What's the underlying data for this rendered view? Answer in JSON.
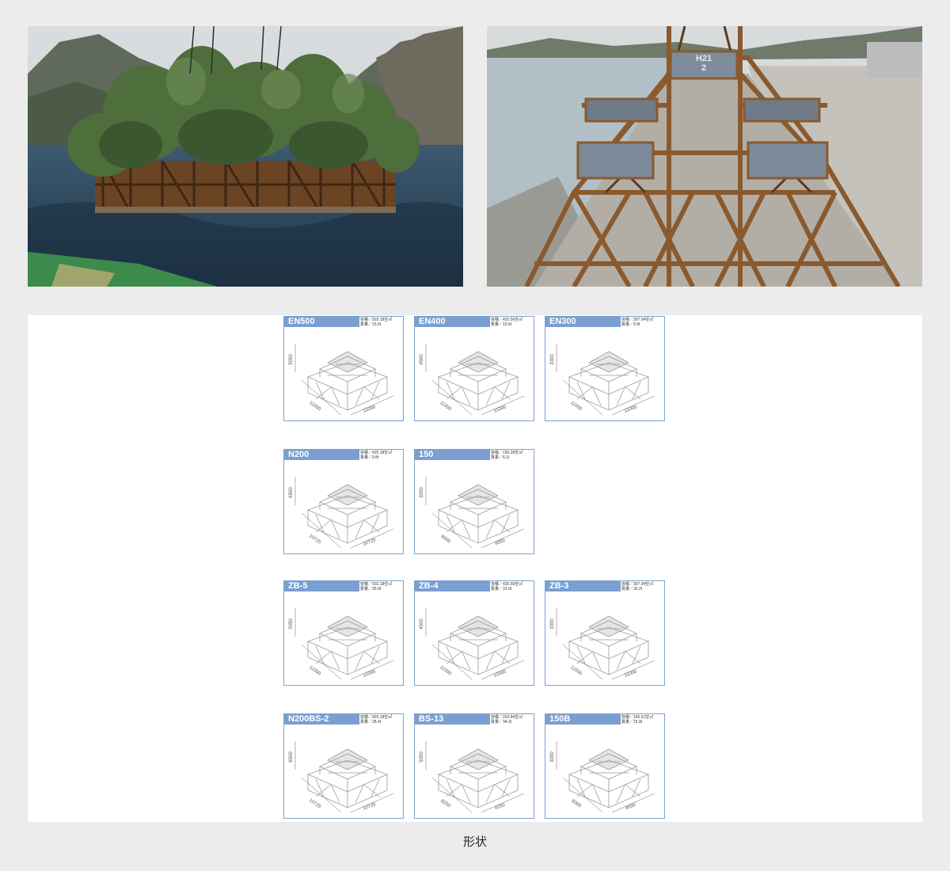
{
  "photos": [
    {
      "id": "left",
      "subject": "tree-topped reef structure lifted above sea"
    },
    {
      "id": "right",
      "subject": "steel frame reef structures on quay",
      "sign_line1": "H21",
      "sign_line2": "2"
    }
  ],
  "products": [
    {
      "name": "EN500",
      "capacity": "容積／502.18空㎥",
      "weight": "質量／15.6t",
      "dims": [
        "11000",
        "11000",
        "5050"
      ]
    },
    {
      "name": "EN400",
      "capacity": "容積／420.56空㎥",
      "weight": "質量／10.6t",
      "dims": [
        "11000",
        "11000",
        "4500"
      ]
    },
    {
      "name": "EN300",
      "capacity": "容積／307.94空㎥",
      "weight": "質量／9.9t",
      "dims": [
        "11000",
        "11000",
        "3300"
      ]
    },
    {
      "name": "N200",
      "capacity": "容積／425.18空㎥",
      "weight": "質量／9.8t",
      "dims": [
        "10725",
        "10725",
        "6500"
      ]
    },
    {
      "name": "150",
      "capacity": "容積／150.28空㎥",
      "weight": "質量／6.1t",
      "dims": [
        "9000",
        "9000",
        "3000"
      ]
    },
    {
      "name": "ZB-5",
      "capacity": "容積／502.18空㎥",
      "weight": "質量／35.9t",
      "dims": [
        "11000",
        "11000",
        "5050"
      ]
    },
    {
      "name": "ZB-4",
      "capacity": "容積／420.56空㎥",
      "weight": "質量／31.0t",
      "dims": [
        "11000",
        "11000",
        "4500"
      ]
    },
    {
      "name": "ZB-3",
      "capacity": "容積／307.94空㎥",
      "weight": "質量／30.2t",
      "dims": [
        "11000",
        "11000",
        "3300"
      ]
    },
    {
      "name": "N200BS-2",
      "capacity": "容積／425.18空㎥",
      "weight": "質量／28.4t",
      "dims": [
        "10725",
        "10725",
        "6500"
      ]
    },
    {
      "name": "BS-13",
      "capacity": "容積／203.84空㎥",
      "weight": "質量／34.2t",
      "dims": [
        "8250",
        "8250",
        "5000"
      ]
    },
    {
      "name": "150B",
      "capacity": "容積／156.51空㎥",
      "weight": "質量／15.9t",
      "dims": [
        "9000",
        "9000",
        "3000"
      ]
    }
  ],
  "caption": "形状",
  "colors": {
    "card_header": "#7a9fd0",
    "card_border": "#7aa3d2",
    "background": "#ececec",
    "rust": "#8a5a2e"
  }
}
